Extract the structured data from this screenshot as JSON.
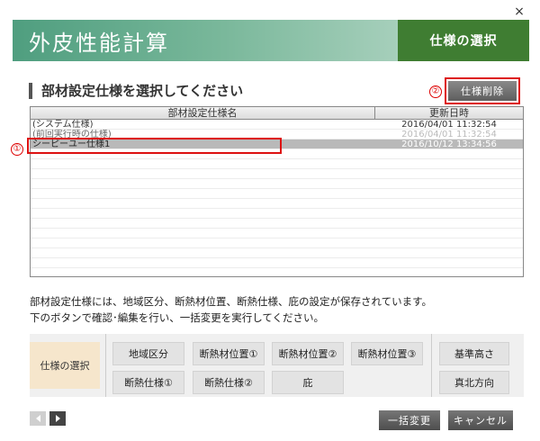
{
  "window": {
    "close_glyph": "×"
  },
  "header": {
    "title": "外皮性能計算",
    "step": "仕様の選択"
  },
  "section": {
    "title": "部材設定仕様を選択してください"
  },
  "markers": {
    "one": "①",
    "two": "②"
  },
  "toolbar": {
    "delete_label": "仕様削除"
  },
  "table": {
    "columns": [
      "部材設定仕様名",
      "更新日時"
    ],
    "rows": [
      {
        "name": "(システム仕様)",
        "date": "2016/04/01 11:32:54",
        "state": "normal"
      },
      {
        "name": "(前回実行時の仕様)",
        "date": "2016/04/01 11:32:54",
        "state": "dim"
      },
      {
        "name": "シーピーユー仕様1",
        "date": "2016/10/12 13:34:56",
        "state": "selected"
      }
    ],
    "empty_rows": 12
  },
  "description": {
    "line1": "部材設定仕様には、地域区分、断熱材位置、断熱仕様、庇の設定が保存されています。",
    "line2": "下のボタンで確認･編集を行い、一括変更を実行してください。"
  },
  "panel": {
    "spec_select": "仕様の選択",
    "buttons": {
      "region": "地域区分",
      "insul_pos1": "断熱材位置①",
      "insul_pos2": "断熱材位置②",
      "insul_pos3": "断熱材位置③",
      "insul_spec1": "断熱仕様①",
      "insul_spec2": "断熱仕様②",
      "eaves": "庇",
      "base_height": "基準高さ",
      "true_north": "真北方向"
    }
  },
  "footer": {
    "bulk_change": "一括変更",
    "cancel": "キャンセル"
  },
  "colors": {
    "header_green": "#4f9e7f",
    "header_step_green": "#3f7d32",
    "highlight_red": "#d11111",
    "selected_row": "#b9b9b9",
    "spec_select_bg": "#f6e6cc"
  }
}
